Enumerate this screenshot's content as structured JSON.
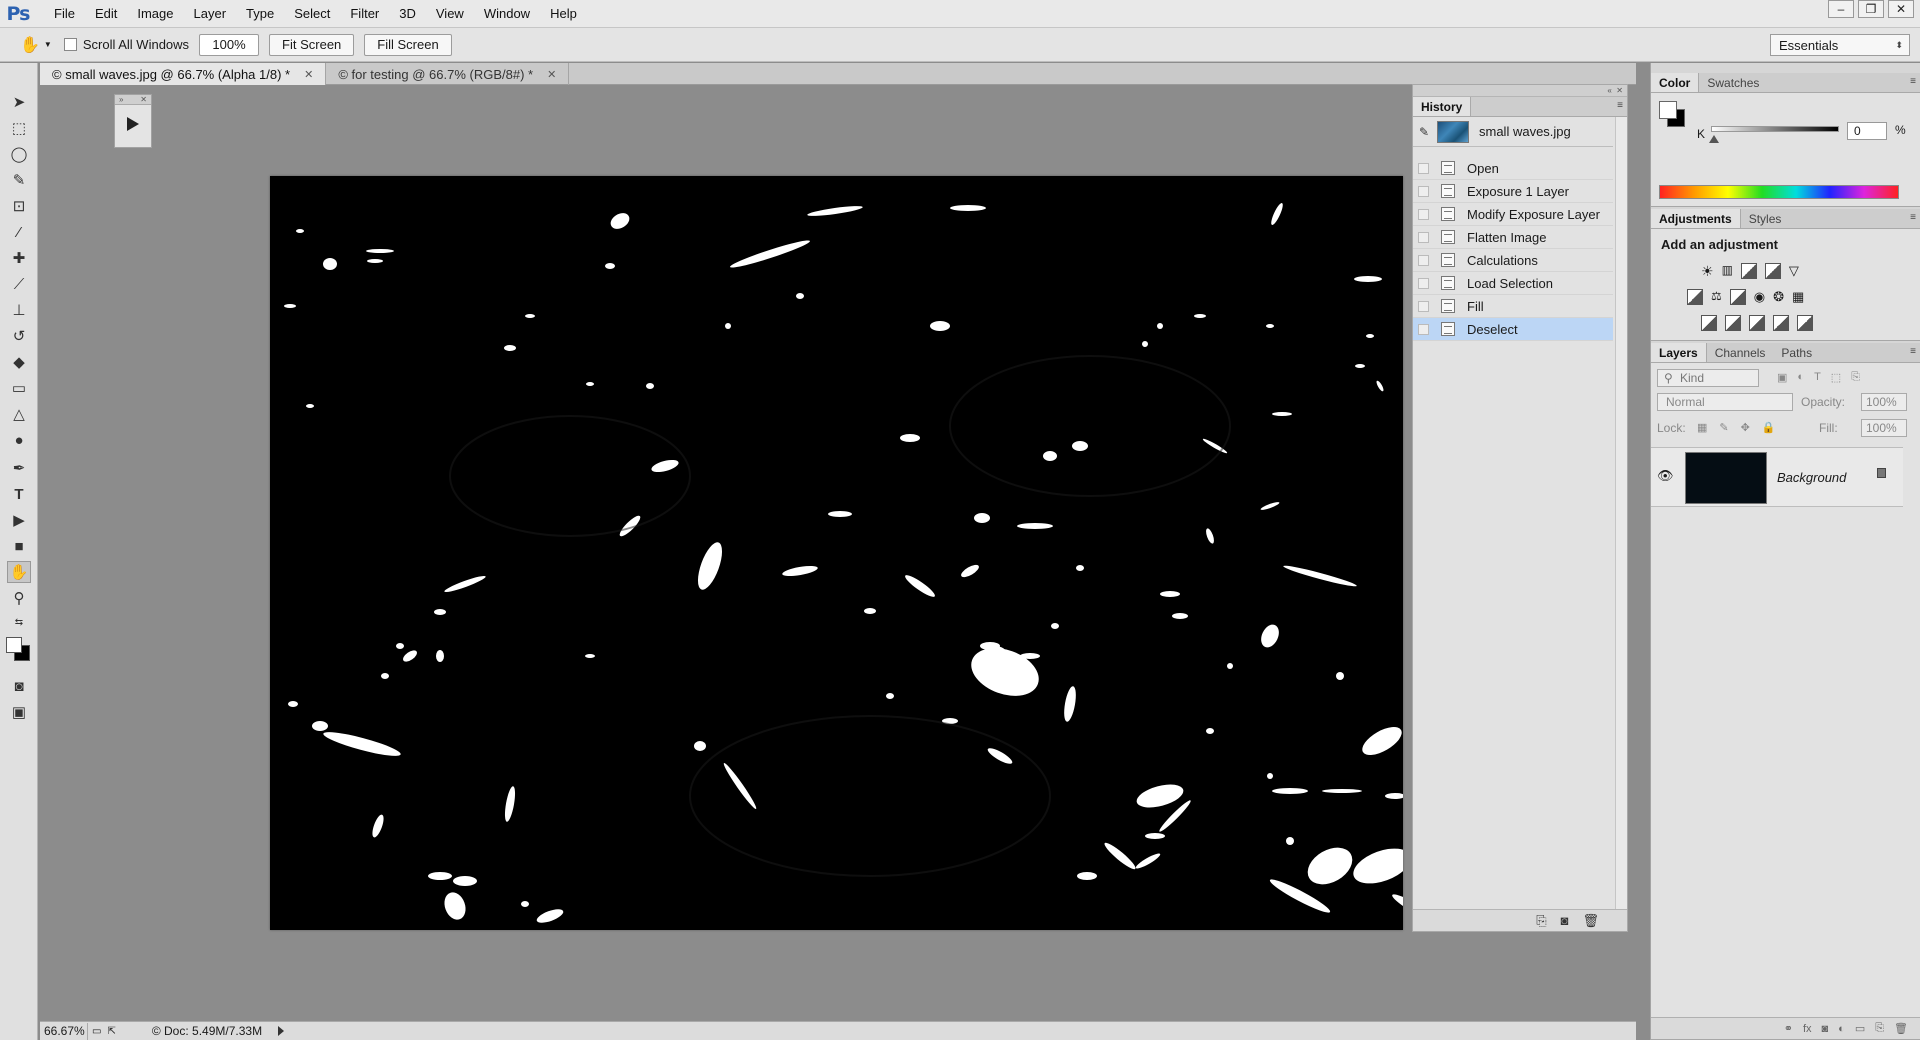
{
  "app": {
    "logo": "Ps"
  },
  "menu": [
    "File",
    "Edit",
    "Image",
    "Layer",
    "Type",
    "Select",
    "Filter",
    "3D",
    "View",
    "Window",
    "Help"
  ],
  "window_controls": {
    "minimize": "–",
    "restore": "❐",
    "close": "✕"
  },
  "options": {
    "scroll_all_windows": "Scroll All Windows",
    "zoom": "100%",
    "fit_screen": "Fit Screen",
    "fill_screen": "Fill Screen",
    "workspace": "Essentials"
  },
  "tabs": [
    {
      "label": "© small waves.jpg @ 66.7% (Alpha 1/8) *",
      "active": true
    },
    {
      "label": "© for testing @ 66.7% (RGB/8#) *",
      "active": false
    }
  ],
  "status": {
    "zoom": "66.67%",
    "doc": "© Doc: 5.49M/7.33M"
  },
  "history": {
    "tab": "History",
    "snapshot": "small waves.jpg",
    "items": [
      "Open",
      "Exposure 1 Layer",
      "Modify Exposure Layer",
      "Flatten Image",
      "Calculations",
      "Load Selection",
      "Fill",
      "Deselect"
    ],
    "selected": "Deselect"
  },
  "color_panel": {
    "tabs": [
      "Color",
      "Swatches"
    ],
    "k_label": "K",
    "k_value": "0",
    "k_unit": "%"
  },
  "adjustments_panel": {
    "tabs": [
      "Adjustments",
      "Styles"
    ],
    "title": "Add an adjustment"
  },
  "layers_panel": {
    "tabs": [
      "Layers",
      "Channels",
      "Paths"
    ],
    "kind": "Kind",
    "blend_mode": "Normal",
    "opacity_label": "Opacity:",
    "opacity": "100%",
    "lock_label": "Lock:",
    "fill_label": "Fill:",
    "fill": "100%",
    "layer_name": "Background"
  },
  "colors": {
    "accent_selected": "#bcd6f5",
    "canvas": "#000000",
    "brand": "#2d62b1"
  }
}
